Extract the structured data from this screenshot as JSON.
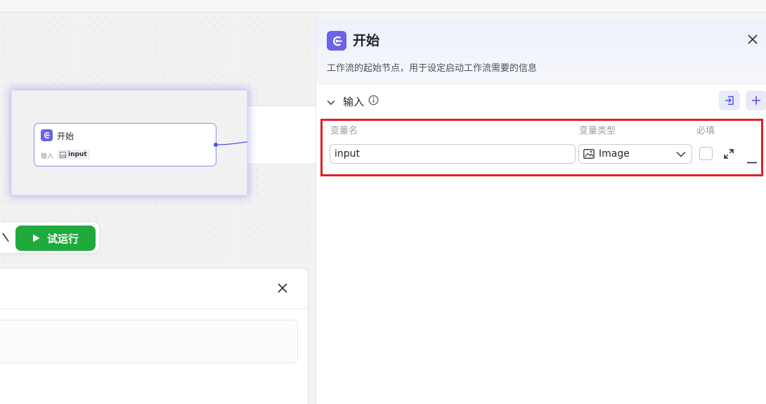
{
  "canvas": {
    "node": {
      "title": "开始",
      "input_label": "输入",
      "var_name": "input"
    },
    "test_run_label": "试运行"
  },
  "panel": {
    "title": "开始",
    "description": "工作流的起始节点，用于设定启动工作流需要的信息",
    "section_label": "输入",
    "columns": {
      "name": "变量名",
      "type": "变量类型",
      "required": "必填"
    },
    "row": {
      "name_value": "input",
      "type_value": "Image",
      "required": false
    }
  },
  "colors": {
    "accent": "#6a62e8",
    "run_button": "#1faa3c",
    "highlight": "#e31e2a"
  },
  "icons": [
    "start-icon",
    "info-icon",
    "import-icon",
    "plus-icon",
    "image-icon",
    "chevron-down-icon",
    "expand-icon",
    "minus-icon",
    "close-icon",
    "play-icon",
    "pen-icon"
  ]
}
